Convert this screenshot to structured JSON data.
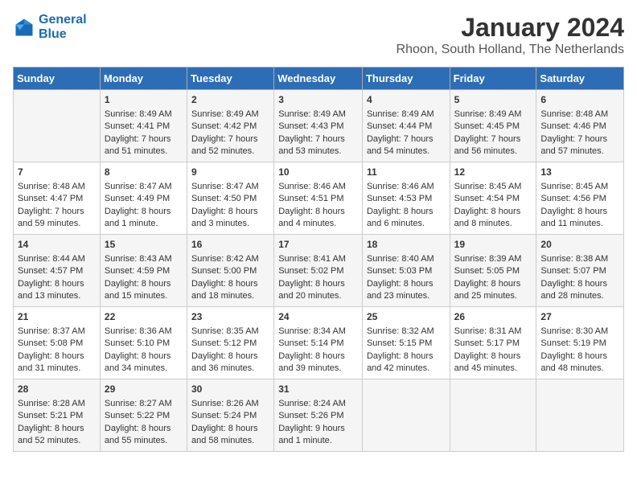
{
  "header": {
    "logo_line1": "General",
    "logo_line2": "Blue",
    "month": "January 2024",
    "location": "Rhoon, South Holland, The Netherlands"
  },
  "days_of_week": [
    "Sunday",
    "Monday",
    "Tuesday",
    "Wednesday",
    "Thursday",
    "Friday",
    "Saturday"
  ],
  "weeks": [
    [
      {
        "day": "",
        "content": ""
      },
      {
        "day": "1",
        "content": "Sunrise: 8:49 AM\nSunset: 4:41 PM\nDaylight: 7 hours\nand 51 minutes."
      },
      {
        "day": "2",
        "content": "Sunrise: 8:49 AM\nSunset: 4:42 PM\nDaylight: 7 hours\nand 52 minutes."
      },
      {
        "day": "3",
        "content": "Sunrise: 8:49 AM\nSunset: 4:43 PM\nDaylight: 7 hours\nand 53 minutes."
      },
      {
        "day": "4",
        "content": "Sunrise: 8:49 AM\nSunset: 4:44 PM\nDaylight: 7 hours\nand 54 minutes."
      },
      {
        "day": "5",
        "content": "Sunrise: 8:49 AM\nSunset: 4:45 PM\nDaylight: 7 hours\nand 56 minutes."
      },
      {
        "day": "6",
        "content": "Sunrise: 8:48 AM\nSunset: 4:46 PM\nDaylight: 7 hours\nand 57 minutes."
      }
    ],
    [
      {
        "day": "7",
        "content": "Sunrise: 8:48 AM\nSunset: 4:47 PM\nDaylight: 7 hours\nand 59 minutes."
      },
      {
        "day": "8",
        "content": "Sunrise: 8:47 AM\nSunset: 4:49 PM\nDaylight: 8 hours\nand 1 minute."
      },
      {
        "day": "9",
        "content": "Sunrise: 8:47 AM\nSunset: 4:50 PM\nDaylight: 8 hours\nand 3 minutes."
      },
      {
        "day": "10",
        "content": "Sunrise: 8:46 AM\nSunset: 4:51 PM\nDaylight: 8 hours\nand 4 minutes."
      },
      {
        "day": "11",
        "content": "Sunrise: 8:46 AM\nSunset: 4:53 PM\nDaylight: 8 hours\nand 6 minutes."
      },
      {
        "day": "12",
        "content": "Sunrise: 8:45 AM\nSunset: 4:54 PM\nDaylight: 8 hours\nand 8 minutes."
      },
      {
        "day": "13",
        "content": "Sunrise: 8:45 AM\nSunset: 4:56 PM\nDaylight: 8 hours\nand 11 minutes."
      }
    ],
    [
      {
        "day": "14",
        "content": "Sunrise: 8:44 AM\nSunset: 4:57 PM\nDaylight: 8 hours\nand 13 minutes."
      },
      {
        "day": "15",
        "content": "Sunrise: 8:43 AM\nSunset: 4:59 PM\nDaylight: 8 hours\nand 15 minutes."
      },
      {
        "day": "16",
        "content": "Sunrise: 8:42 AM\nSunset: 5:00 PM\nDaylight: 8 hours\nand 18 minutes."
      },
      {
        "day": "17",
        "content": "Sunrise: 8:41 AM\nSunset: 5:02 PM\nDaylight: 8 hours\nand 20 minutes."
      },
      {
        "day": "18",
        "content": "Sunrise: 8:40 AM\nSunset: 5:03 PM\nDaylight: 8 hours\nand 23 minutes."
      },
      {
        "day": "19",
        "content": "Sunrise: 8:39 AM\nSunset: 5:05 PM\nDaylight: 8 hours\nand 25 minutes."
      },
      {
        "day": "20",
        "content": "Sunrise: 8:38 AM\nSunset: 5:07 PM\nDaylight: 8 hours\nand 28 minutes."
      }
    ],
    [
      {
        "day": "21",
        "content": "Sunrise: 8:37 AM\nSunset: 5:08 PM\nDaylight: 8 hours\nand 31 minutes."
      },
      {
        "day": "22",
        "content": "Sunrise: 8:36 AM\nSunset: 5:10 PM\nDaylight: 8 hours\nand 34 minutes."
      },
      {
        "day": "23",
        "content": "Sunrise: 8:35 AM\nSunset: 5:12 PM\nDaylight: 8 hours\nand 36 minutes."
      },
      {
        "day": "24",
        "content": "Sunrise: 8:34 AM\nSunset: 5:14 PM\nDaylight: 8 hours\nand 39 minutes."
      },
      {
        "day": "25",
        "content": "Sunrise: 8:32 AM\nSunset: 5:15 PM\nDaylight: 8 hours\nand 42 minutes."
      },
      {
        "day": "26",
        "content": "Sunrise: 8:31 AM\nSunset: 5:17 PM\nDaylight: 8 hours\nand 45 minutes."
      },
      {
        "day": "27",
        "content": "Sunrise: 8:30 AM\nSunset: 5:19 PM\nDaylight: 8 hours\nand 48 minutes."
      }
    ],
    [
      {
        "day": "28",
        "content": "Sunrise: 8:28 AM\nSunset: 5:21 PM\nDaylight: 8 hours\nand 52 minutes."
      },
      {
        "day": "29",
        "content": "Sunrise: 8:27 AM\nSunset: 5:22 PM\nDaylight: 8 hours\nand 55 minutes."
      },
      {
        "day": "30",
        "content": "Sunrise: 8:26 AM\nSunset: 5:24 PM\nDaylight: 8 hours\nand 58 minutes."
      },
      {
        "day": "31",
        "content": "Sunrise: 8:24 AM\nSunset: 5:26 PM\nDaylight: 9 hours\nand 1 minute."
      },
      {
        "day": "",
        "content": ""
      },
      {
        "day": "",
        "content": ""
      },
      {
        "day": "",
        "content": ""
      }
    ]
  ]
}
